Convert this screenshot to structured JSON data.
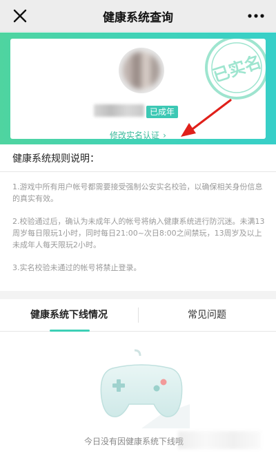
{
  "topbar": {
    "title": "健康系统查询"
  },
  "profile": {
    "status_badge": "已成年",
    "modify_link": "修改实名认证",
    "stamp_text": "已实名"
  },
  "rules": {
    "title": "健康系统规则说明：",
    "items": [
      "1.游戏中所有用户帐号都需要接受强制公安实名校验，以确保相关身份信息的真实有效。",
      "2.校验通过后，确认为未成年人的帐号将纳入健康系统进行防沉迷。未满13周岁每日限玩1小时，同时每日21:00~次日8:00之间禁玩，13周岁及以上未成年人每天限玩2小时。",
      "3.实名校验未通过的帐号将禁止登录。"
    ]
  },
  "tabs": [
    {
      "label": "健康系统下线情况"
    },
    {
      "label": "常见问题"
    }
  ],
  "empty_state": {
    "text": "今日没有因健康系统下线哦"
  },
  "colors": {
    "accent": "#3ccfb6",
    "banner_start": "#4fd4a0",
    "banner_end": "#37cfc8"
  }
}
